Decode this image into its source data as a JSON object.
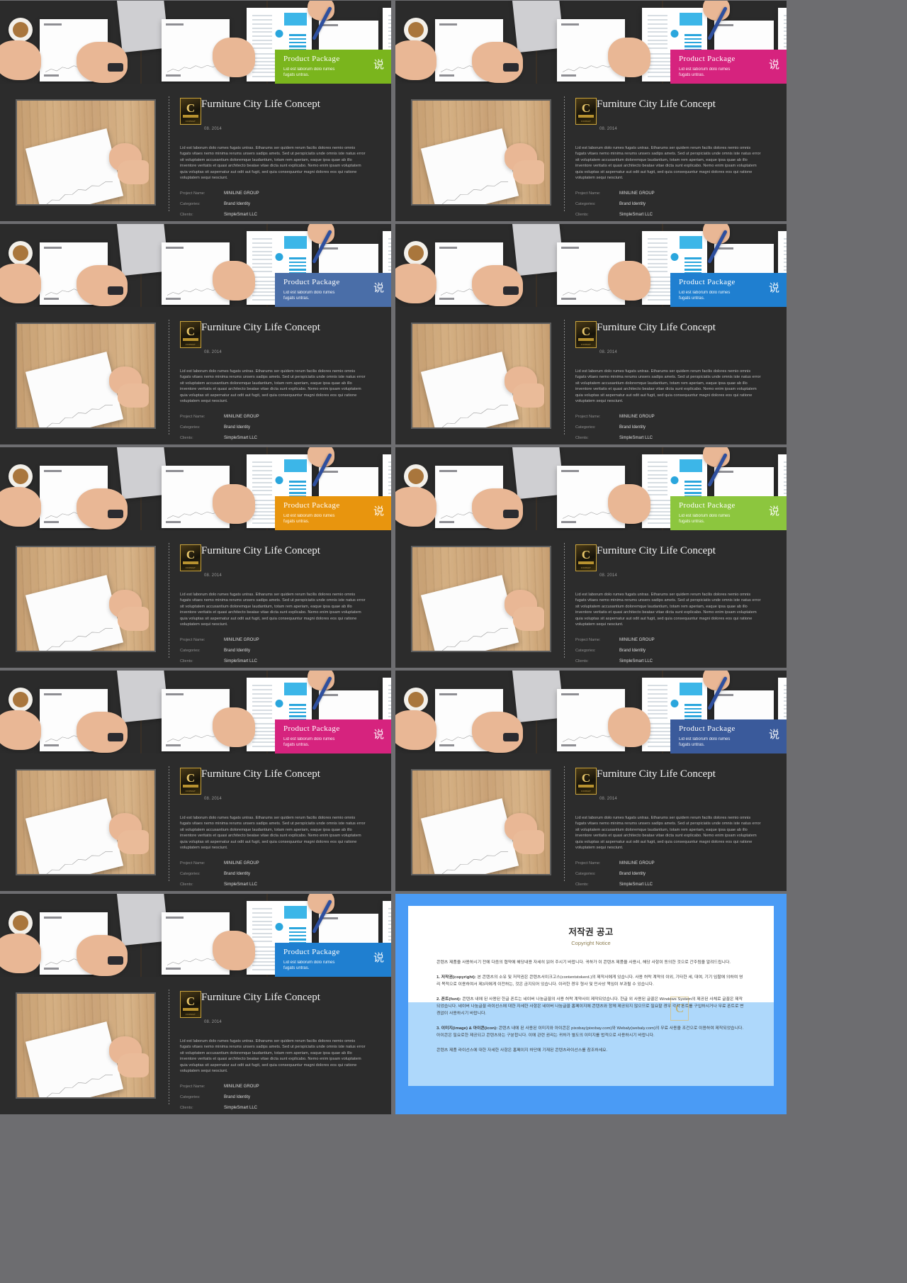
{
  "slides": [
    {
      "accent": "#7ab51d",
      "promo": {
        "title": "Product Package",
        "subtitle": "Lid est laborum dolo rumes\nfugats untras.",
        "cjk": "说"
      },
      "headline": "Furniture City Life Concept",
      "date": "08. 2014",
      "logo_letter": "C",
      "logo_mark": "CONTENTS",
      "logo_sub": "FORMAT",
      "paragraph": "Lid est laborum dolo rumes fugats untras. Etharums ser quidem rerum facilis dolores nemio omnis fugats vitaes nemo minima rerums unsers sadips amets. Sed ut perspiciatis unde omnis iste natus error sit voluptatem accusantium doloremque laudantium, totam rem aperiam, eaque ipsa quae ab illo inventore veritatis et quasi architecto beatae vitae dicta sunt explicabo. Nemo enim ipsam voluptatem quia voluptas sit aspernatur aut odit aut fugit, sed quia consequuntur magni dolores eos qui ratione voluptatem sequi nesciunt.",
      "meta": [
        {
          "key": "Project Name:",
          "value": "MINILINE GROUP"
        },
        {
          "key": "Categories:",
          "value": "Brand Identity"
        },
        {
          "key": "Clients:",
          "value": "SimpleSmart LLC"
        }
      ]
    },
    {
      "accent": "#d6237e",
      "promo": {
        "title": "Product Package",
        "subtitle": "Lid est laborum dolo rumes\nfugats untras.",
        "cjk": "说"
      },
      "headline": "Furniture City Life Concept",
      "date": "08. 2014",
      "logo_letter": "C",
      "logo_mark": "CONTENTS",
      "logo_sub": "FORMAT",
      "paragraph": "Lid est laborum dolo rumes fugats untras. Etharums ser quidem rerum facilis dolores nemio omnis fugats vitaes nemo minima rerums unsers sadips amets. Sed ut perspiciatis unde omnis iste natus error sit voluptatem accusantium doloremque laudantium, totam rem aperiam, eaque ipsa quae ab illo inventore veritatis et quasi architecto beatae vitae dicta sunt explicabo. Nemo enim ipsam voluptatem quia voluptas sit aspernatur aut odit aut fugit, sed quia consequuntur magni dolores eos qui ratione voluptatem sequi nesciunt.",
      "meta": [
        {
          "key": "Project Name:",
          "value": "MINILINE GROUP"
        },
        {
          "key": "Categories:",
          "value": "Brand Identity"
        },
        {
          "key": "Clients:",
          "value": "SimpleSmart LLC"
        }
      ]
    },
    {
      "accent": "#4a6ea8",
      "promo": {
        "title": "Product Package",
        "subtitle": "Lid est laborum dolo rumes\nfugats untras.",
        "cjk": "说"
      },
      "headline": "Furniture City Life Concept",
      "date": "08. 2014",
      "logo_letter": "C",
      "logo_mark": "CONTENTS",
      "logo_sub": "FORMAT",
      "paragraph": "Lid est laborum dolo rumes fugats untras. Etharums ser quidem rerum facilis dolores nemio omnis fugats vitaes nemo minima rerums unsers sadips amets. Sed ut perspiciatis unde omnis iste natus error sit voluptatem accusantium doloremque laudantium, totam rem aperiam, eaque ipsa quae ab illo inventore veritatis et quasi architecto beatae vitae dicta sunt explicabo. Nemo enim ipsam voluptatem quia voluptas sit aspernatur aut odit aut fugit, sed quia consequuntur magni dolores eos qui ratione voluptatem sequi nesciunt.",
      "meta": [
        {
          "key": "Project Name:",
          "value": "MINILINE GROUP"
        },
        {
          "key": "Categories:",
          "value": "Brand Identity"
        },
        {
          "key": "Clients:",
          "value": "SimpleSmart LLC"
        }
      ]
    },
    {
      "accent": "#1f7fd0",
      "promo": {
        "title": "Product Package",
        "subtitle": "Lid est laborum dolo rumes\nfugats untras.",
        "cjk": "说"
      },
      "headline": "Furniture City Life Concept",
      "date": "08. 2014",
      "logo_letter": "C",
      "logo_mark": "CONTENTS",
      "logo_sub": "FORMAT",
      "paragraph": "Lid est laborum dolo rumes fugats untras. Etharums ser quidem rerum facilis dolores nemio omnis fugats vitaes nemo minima rerums unsers sadips amets. Sed ut perspiciatis unde omnis iste natus error sit voluptatem accusantium doloremque laudantium, totam rem aperiam, eaque ipsa quae ab illo inventore veritatis et quasi architecto beatae vitae dicta sunt explicabo. Nemo enim ipsam voluptatem quia voluptas sit aspernatur aut odit aut fugit, sed quia consequuntur magni dolores eos qui ratione voluptatem sequi nesciunt.",
      "meta": [
        {
          "key": "Project Name:",
          "value": "MINILINE GROUP"
        },
        {
          "key": "Categories:",
          "value": "Brand Identity"
        },
        {
          "key": "Clients:",
          "value": "SimpleSmart LLC"
        }
      ]
    },
    {
      "accent": "#e8950e",
      "promo": {
        "title": "Product Package",
        "subtitle": "Lid est laborum dolo rumes\nfugats untras.",
        "cjk": "说"
      },
      "headline": "Furniture City Life Concept",
      "date": "08. 2014",
      "logo_letter": "C",
      "logo_mark": "CONTENTS",
      "logo_sub": "FORMAT",
      "paragraph": "Lid est laborum dolo rumes fugats untras. Etharums ser quidem rerum facilis dolores nemio omnis fugats vitaes nemo minima rerums unsers sadips amets. Sed ut perspiciatis unde omnis iste natus error sit voluptatem accusantium doloremque laudantium, totam rem aperiam, eaque ipsa quae ab illo inventore veritatis et quasi architecto beatae vitae dicta sunt explicabo. Nemo enim ipsam voluptatem quia voluptas sit aspernatur aut odit aut fugit, sed quia consequuntur magni dolores eos qui ratione voluptatem sequi nesciunt.",
      "meta": [
        {
          "key": "Project Name:",
          "value": "MINILINE GROUP"
        },
        {
          "key": "Categories:",
          "value": "Brand Identity"
        },
        {
          "key": "Clients:",
          "value": "SimpleSmart LLC"
        }
      ]
    },
    {
      "accent": "#8cc63e",
      "promo": {
        "title": "Product Package",
        "subtitle": "Lid est laborum dolo rumes\nfugats untras.",
        "cjk": "说"
      },
      "headline": "Furniture City Life Concept",
      "date": "08. 2014",
      "logo_letter": "C",
      "logo_mark": "CONTENTS",
      "logo_sub": "FORMAT",
      "paragraph": "Lid est laborum dolo rumes fugats untras. Etharums ser quidem rerum facilis dolores nemio omnis fugats vitaes nemo minima rerums unsers sadips amets. Sed ut perspiciatis unde omnis iste natus error sit voluptatem accusantium doloremque laudantium, totam rem aperiam, eaque ipsa quae ab illo inventore veritatis et quasi architecto beatae vitae dicta sunt explicabo. Nemo enim ipsam voluptatem quia voluptas sit aspernatur aut odit aut fugit, sed quia consequuntur magni dolores eos qui ratione voluptatem sequi nesciunt.",
      "meta": [
        {
          "key": "Project Name:",
          "value": "MINILINE GROUP"
        },
        {
          "key": "Categories:",
          "value": "Brand Identity"
        },
        {
          "key": "Clients:",
          "value": "SimpleSmart LLC"
        }
      ]
    },
    {
      "accent": "#d6237e",
      "promo": {
        "title": "Product Package",
        "subtitle": "Lid est laborum dolo rumes\nfugats untras.",
        "cjk": "说"
      },
      "headline": "Furniture City Life Concept",
      "date": "08. 2014",
      "logo_letter": "C",
      "logo_mark": "CONTENTS",
      "logo_sub": "FORMAT",
      "paragraph": "Lid est laborum dolo rumes fugats untras. Etharums ser quidem rerum facilis dolores nemio omnis fugats vitaes nemo minima rerums unsers sadips amets. Sed ut perspiciatis unde omnis iste natus error sit voluptatem accusantium doloremque laudantium, totam rem aperiam, eaque ipsa quae ab illo inventore veritatis et quasi architecto beatae vitae dicta sunt explicabo. Nemo enim ipsam voluptatem quia voluptas sit aspernatur aut odit aut fugit, sed quia consequuntur magni dolores eos qui ratione voluptatem sequi nesciunt.",
      "meta": [
        {
          "key": "Project Name:",
          "value": "MINILINE GROUP"
        },
        {
          "key": "Categories:",
          "value": "Brand Identity"
        },
        {
          "key": "Clients:",
          "value": "SimpleSmart LLC"
        }
      ]
    },
    {
      "accent": "#3a5a9b",
      "promo": {
        "title": "Product Package",
        "subtitle": "Lid est laborum dolo rumes\nfugats untras.",
        "cjk": "说"
      },
      "headline": "Furniture City Life Concept",
      "date": "08. 2014",
      "logo_letter": "C",
      "logo_mark": "CONTENTS",
      "logo_sub": "FORMAT",
      "paragraph": "Lid est laborum dolo rumes fugats untras. Etharums ser quidem rerum facilis dolores nemio omnis fugats vitaes nemo minima rerums unsers sadips amets. Sed ut perspiciatis unde omnis iste natus error sit voluptatem accusantium doloremque laudantium, totam rem aperiam, eaque ipsa quae ab illo inventore veritatis et quasi architecto beatae vitae dicta sunt explicabo. Nemo enim ipsam voluptatem quia voluptas sit aspernatur aut odit aut fugit, sed quia consequuntur magni dolores eos qui ratione voluptatem sequi nesciunt.",
      "meta": [
        {
          "key": "Project Name:",
          "value": "MINILINE GROUP"
        },
        {
          "key": "Categories:",
          "value": "Brand Identity"
        },
        {
          "key": "Clients:",
          "value": "SimpleSmart LLC"
        }
      ]
    },
    {
      "accent": "#1f7fd0",
      "promo": {
        "title": "Product Package",
        "subtitle": "Lid est laborum dolo rumes\nfugats untras.",
        "cjk": "说"
      },
      "headline": "Furniture City Life Concept",
      "date": "08. 2014",
      "logo_letter": "C",
      "logo_mark": "CONTENTS",
      "logo_sub": "FORMAT",
      "paragraph": "Lid est laborum dolo rumes fugats untras. Etharums ser quidem rerum facilis dolores nemio omnis fugats vitaes nemo minima rerums unsers sadips amets. Sed ut perspiciatis unde omnis iste natus error sit voluptatem accusantium doloremque laudantium, totam rem aperiam, eaque ipsa quae ab illo inventore veritatis et quasi architecto beatae vitae dicta sunt explicabo. Nemo enim ipsam voluptatem quia voluptas sit aspernatur aut odit aut fugit, sed quia consequuntur magni dolores eos qui ratione voluptatem sequi nesciunt.",
      "meta": [
        {
          "key": "Project Name:",
          "value": "MINILINE GROUP"
        },
        {
          "key": "Categories:",
          "value": "Brand Identity"
        },
        {
          "key": "Clients:",
          "value": "SimpleSmart LLC"
        }
      ]
    }
  ],
  "copyright": {
    "bg_color": "#4a9bf5",
    "title": "저작권 공고",
    "subtitle": "Copyright Notice",
    "intro": "콘텐츠 제품을 사용하시기 전에 다음의 협약에 해당내용 자세히 읽어 주시기 바랍니다. 귀하가 이 콘텐츠 제품을 사용시, 해당 사항이 동의한 것으로 간주됨을 알려드립니다.",
    "sections": [
      {
        "label": "1. 저작권(copyright):",
        "text": "본 콘텐츠의 소유 및 저작권은 콘텐츠서이크고스(contentstokerd.)의 제작사에게 있습니다. 사용 허락 계약의 이외, 기타한 세, 대여, 기기 임팔에 의하여 영리 목적으로 이용하여서 제3자에게 이전하는, 것은 금지되어 있습니다. 이러한 경우 형사 및 민사상 책임이 부과될 수 있습니다."
      },
      {
        "label": "2. 폰트(font):",
        "text": "콘텐츠 내에 된 사용된 한글 폰트는 네이버 나눔글꼴의 사용 허락 계약사이 제작되었습니다. 한글 외 사용된 글꼴은 Windows System의 제공된 사체로 글꼴은 제작되었습니다. 네이버 나눔글꼴 라이선스에 대한 자세한 사항은 네이버 나눔글꼴 홈페이지에 콘텐츠와 함께 제공되지 않으므로 필요할 경우 각각 폰트를 구입하시거나 무료 폰트로 변경없이 사용하시기 바랍니다."
      },
      {
        "label": "3. 이미지(image) & 아이콘(icon):",
        "text": "콘텐츠 내에 된 사용된 이미지와 아이콘은 pixobay(pixobay.com)와 Webaly(webaly.com)의 무료 사용을 조건으로 이용하여 제작되었습니다. 아이콘은 필요로한 제공되고 콘텐츠와는 구분합니다. 이에 관련 권리는 귀하가 별도의 이미지를 법적으로 사용하시기 바랍니다."
      }
    ],
    "footer": "콘텐츠 제품 라이선스에 대한 자세한 사항은 홈페이지 하단에 기재된 콘텐츠라이선스를 참조하세요.",
    "watermark_letter": "C"
  }
}
